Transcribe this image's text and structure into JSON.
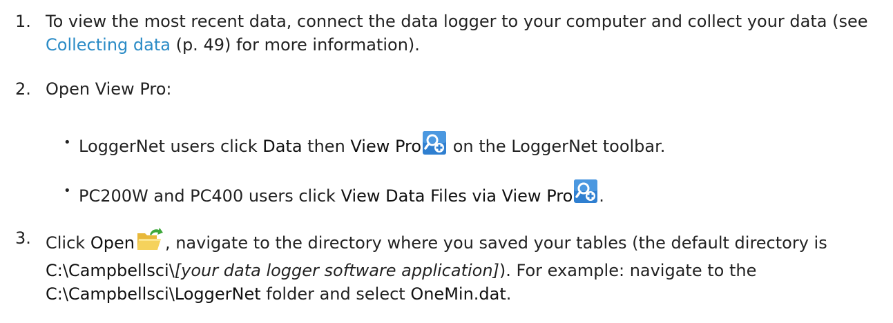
{
  "step1": {
    "number": "1.",
    "text_a": "To view the most recent data, connect the data logger to your computer and collect your data (see ",
    "link": "Collecting data",
    "text_b": " (p. 49) for more information)."
  },
  "step2": {
    "number": "2.",
    "text": "Open View Pro:"
  },
  "bullet1": {
    "dot": "•",
    "text_a": "LoggerNet users click ",
    "bold_a": "Data",
    "text_b": " then ",
    "bold_b": "View Pro",
    "text_c": " on the LoggerNet toolbar.",
    "icon": "view-pro-icon"
  },
  "bullet2": {
    "dot": "•",
    "text_a": "PC200W and PC400 users click ",
    "bold_a": "View Data Files via View Pro",
    "text_b": ".",
    "icon": "view-pro-icon"
  },
  "step3": {
    "number": "3.",
    "text_a": "Click ",
    "bold_open": "Open",
    "text_b": ", navigate to the directory where you saved your tables (the default directory is ",
    "bold_path": "C:\\Campbellsci\\",
    "italic_path": "[your data logger software application]",
    "text_c": "). For example: navigate to the ",
    "bold_folder": "C:\\Campbellsci\\LoggerNet",
    "text_d": " folder and select ",
    "bold_file": "OneMin.dat",
    "text_e": ".",
    "icon": "open-folder-icon"
  },
  "colors": {
    "link": "#2a8bc6",
    "text": "#222222",
    "icon_blue": "#2f7fd0",
    "folder_yellow": "#f2c84a",
    "arrow_green": "#3da83a"
  }
}
